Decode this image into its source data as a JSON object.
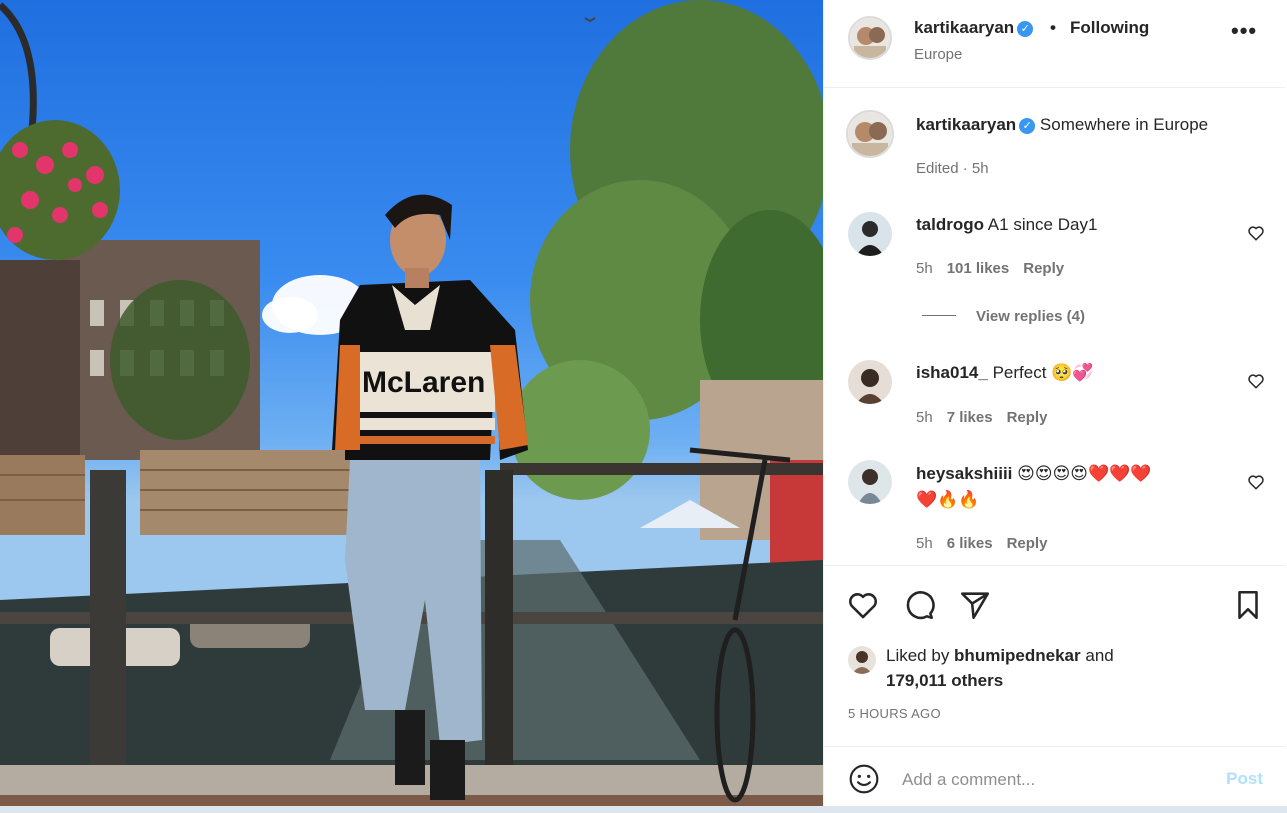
{
  "header": {
    "username": "kartikaaryan",
    "verified_badge": "✓",
    "separator": "•",
    "follow_status": "Following",
    "location": "Europe",
    "more_icon": "more-horizontal-icon"
  },
  "caption": {
    "username": "kartikaaryan",
    "text": "Somewhere in Europe",
    "edited": "Edited · 5h"
  },
  "comments": [
    {
      "username": "taldrogo",
      "text": "A1 since Day1",
      "time": "5h",
      "likes": "101 likes",
      "reply": "Reply",
      "view_replies": "View replies (4)"
    },
    {
      "username": "isha014_",
      "text": "Perfect 🥺💞",
      "time": "5h",
      "likes": "7 likes",
      "reply": "Reply"
    },
    {
      "username": "heysakshiiii",
      "text": "😍😍😍😍❤️❤️❤️",
      "text2": "❤️🔥🔥",
      "time": "5h",
      "likes": "6 likes",
      "reply": "Reply"
    }
  ],
  "likes": {
    "prefix": "Liked by ",
    "liker": "bhumipednekar",
    "conjunction": " and",
    "others": "179,011 others"
  },
  "timestamp": "5 HOURS AGO",
  "add_comment": {
    "placeholder": "Add a comment...",
    "post_label": "Post"
  },
  "photo": {
    "shirt_text": "McLaren"
  },
  "colors": {
    "verified": "#3897f0",
    "post_disabled": "#b2dffc",
    "muted": "#737373"
  }
}
